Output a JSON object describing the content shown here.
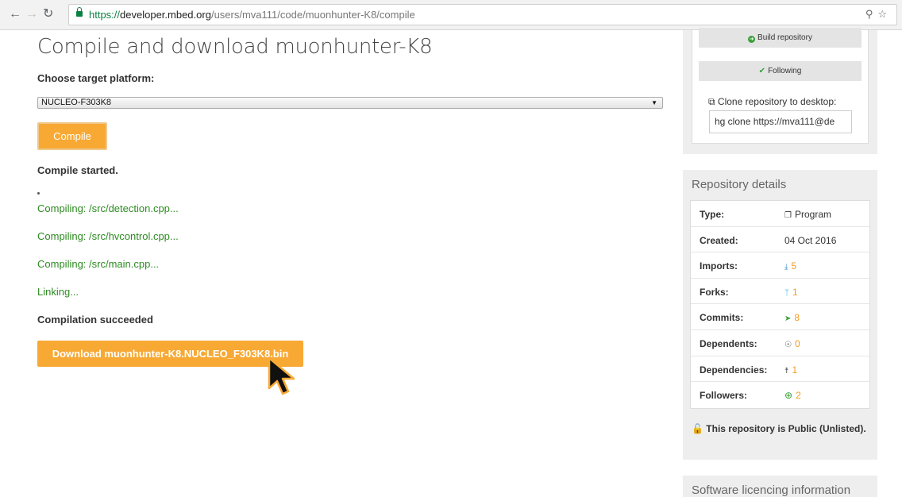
{
  "browser": {
    "back_icon": "back-arrow-icon",
    "forward_icon": "forward-arrow-icon",
    "reload_icon": "reload-icon",
    "url_scheme": "https://",
    "url_host": "developer.mbed.org",
    "url_path": "/users/mva111/code/muonhunter-K8/compile"
  },
  "main": {
    "title": "Compile and download muonhunter-K8",
    "platform_label": "Choose target platform:",
    "platform_selected": "NUCLEO-F303K8",
    "compile_label": "Compile",
    "status": {
      "started": "Compile started.",
      "dot": ".",
      "lines": [
        "Compiling: /src/detection.cpp...",
        "Compiling: /src/hvcontrol.cpp...",
        "Compiling: /src/main.cpp...",
        "Linking..."
      ],
      "succeeded": "Compilation succeeded"
    },
    "download_label": "Download muonhunter-K8.NUCLEO_F303K8.bin"
  },
  "sidebar": {
    "build_label": "Build repository",
    "following_label": "Following",
    "clone_label": "Clone repository to desktop:",
    "clone_value": "hg clone https://mva111@de",
    "repo_heading": "Repository details",
    "repo_rows": [
      {
        "key": "Type:",
        "value": "Program",
        "icon": "box-icon"
      },
      {
        "key": "Created:",
        "value": "04 Oct 2016",
        "icon": ""
      },
      {
        "key": "Imports:",
        "value": "5",
        "icon": "import-icon"
      },
      {
        "key": "Forks:",
        "value": "1",
        "icon": "fork-icon"
      },
      {
        "key": "Commits:",
        "value": "8",
        "icon": "commit-icon"
      },
      {
        "key": "Dependents:",
        "value": "0",
        "icon": "sitemap-icon"
      },
      {
        "key": "Dependencies:",
        "value": "1",
        "icon": "dependency-icon"
      },
      {
        "key": "Followers:",
        "value": "2",
        "icon": "plus-circle-icon"
      }
    ],
    "public_note": "This repository is Public (Unlisted).",
    "licencing_heading": "Software licencing information"
  },
  "colors": {
    "accent": "#f7a934",
    "success_text": "#2e8b22",
    "value_orange": "#f29c1f",
    "icon_green": "#39a03a"
  }
}
